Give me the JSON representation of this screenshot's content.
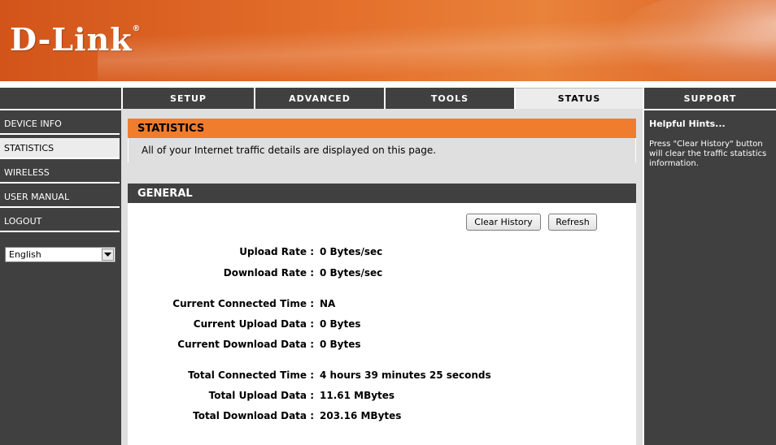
{
  "brand": {
    "logo": "D-Link",
    "registered": "®"
  },
  "nav": {
    "tabs": [
      {
        "label": "SETUP"
      },
      {
        "label": "ADVANCED"
      },
      {
        "label": "TOOLS"
      },
      {
        "label": "STATUS",
        "active": true
      },
      {
        "label": "SUPPORT"
      }
    ]
  },
  "sidebar": {
    "items": [
      {
        "label": "DEVICE INFO"
      },
      {
        "label": "STATISTICS",
        "active": true
      },
      {
        "label": "WIRELESS"
      },
      {
        "label": "USER MANUAL"
      },
      {
        "label": "LOGOUT"
      }
    ],
    "language": {
      "selected": "English"
    }
  },
  "statistics": {
    "title": "STATISTICS",
    "description": "All of your Internet traffic details are displayed on this page."
  },
  "general": {
    "title": "GENERAL",
    "buttons": {
      "clear_history": "Clear History",
      "refresh": "Refresh"
    },
    "rows": [
      {
        "label": "Upload Rate :",
        "value": "0 Bytes/sec"
      },
      {
        "label": "Download Rate :",
        "value": "0 Bytes/sec"
      },
      {
        "label": "Current Connected Time :",
        "value": "NA"
      },
      {
        "label": "Current Upload Data :",
        "value": "0 Bytes"
      },
      {
        "label": "Current Download Data :",
        "value": "0 Bytes"
      },
      {
        "label": "Total Connected Time :",
        "value": "4 hours 39 minutes 25 seconds"
      },
      {
        "label": "Total Upload Data :",
        "value": "11.61 MBytes"
      },
      {
        "label": "Total Download Data :",
        "value": "203.16 MBytes"
      }
    ]
  },
  "hints": {
    "title": "Helpful Hints...",
    "text": "Press \"Clear History\" button will clear the traffic statistics information."
  },
  "colors": {
    "accent_orange": "#f07d2e",
    "dark_gray": "#404040",
    "panel_gray": "#dfdfdf"
  },
  "icons": {
    "dropdown": "chevron-down-icon"
  }
}
